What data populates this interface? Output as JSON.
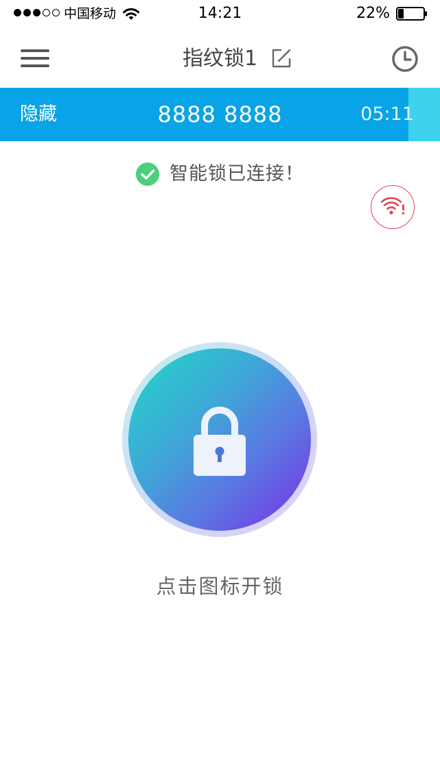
{
  "status_bar": {
    "carrier": "中国移动",
    "time": "14:21",
    "battery_percent": "22%",
    "battery_level": 0.22,
    "signal_bars_filled": 3,
    "signal_bars_total": 5
  },
  "nav": {
    "title": "指纹锁1",
    "menu_icon": "hamburger-menu-icon",
    "edit_icon": "edit-icon",
    "history_icon": "clock-icon"
  },
  "password_banner": {
    "hide_label": "隐藏",
    "code": "8888 8888",
    "countdown": "05:11",
    "background_color": "#09a3e8",
    "remaining_color": "#3fd2ef"
  },
  "connection": {
    "status_text": "智能锁已连接！",
    "status_icon": "check-circle-icon",
    "status_color": "#4cd07d",
    "alert_icon": "wifi-alert-icon",
    "alert_color": "#e0405a"
  },
  "unlock": {
    "icon": "lock-icon",
    "hint": "点击图标开锁"
  }
}
